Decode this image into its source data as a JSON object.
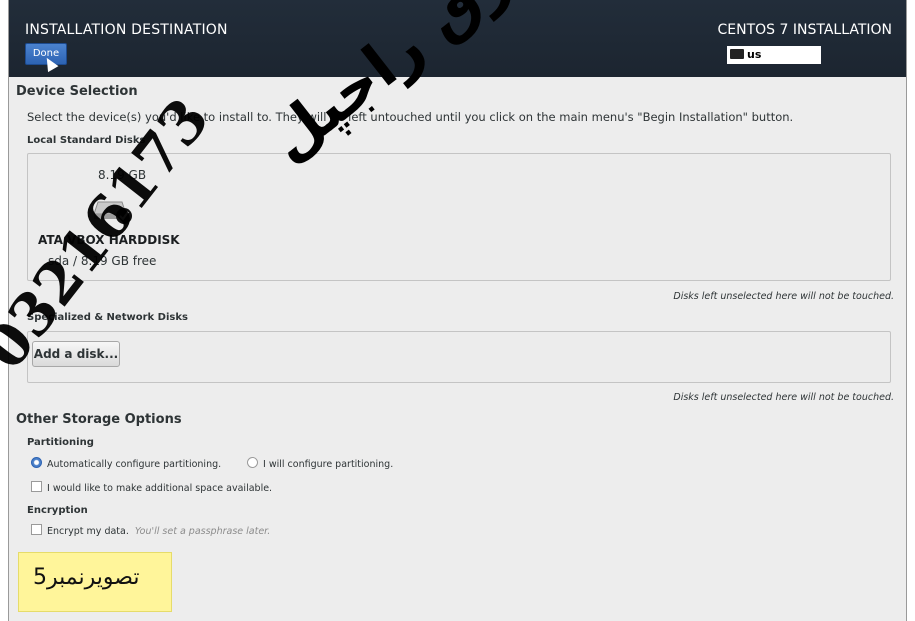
{
  "header": {
    "title": "INSTALLATION DESTINATION",
    "done_label": "Done",
    "product": "CENTOS 7 INSTALLATION",
    "keyboard_layout": "us"
  },
  "device_selection": {
    "title": "Device Selection",
    "description": "Select the device(s) you'd like to install to.  They will be left untouched until you click on the main menu's \"Begin Installation\" button.",
    "local_heading": "Local Standard Disks",
    "disk": {
      "size": "8.19 GB",
      "name": "ATA VBOX HARDDISK",
      "free": "sda  /  8.19 GB free"
    },
    "local_note": "Disks left unselected here will not be touched.",
    "specialized_heading": "Specialized & Network Disks",
    "add_disk_label": "Add a disk...",
    "specialized_note": "Disks left unselected here will not be touched."
  },
  "storage_options": {
    "title": "Other Storage Options",
    "partitioning_heading": "Partitioning",
    "auto_label": "Automatically configure partitioning.",
    "manual_label": "I will configure partitioning.",
    "extra_space_label": "I would like to make additional space available.",
    "encryption_heading": "Encryption",
    "encrypt_label": "Encrypt my data.",
    "encrypt_hint": "You'll set a passphrase later."
  },
  "overlay": {
    "caption": "تصویرنمبر5",
    "watermark_number": "03216173",
    "watermark_name": "طارق راجپل"
  },
  "colors": {
    "header_bg": "#1f2833",
    "done_button": "#3a72c4",
    "caption_bg": "#fff59a"
  }
}
